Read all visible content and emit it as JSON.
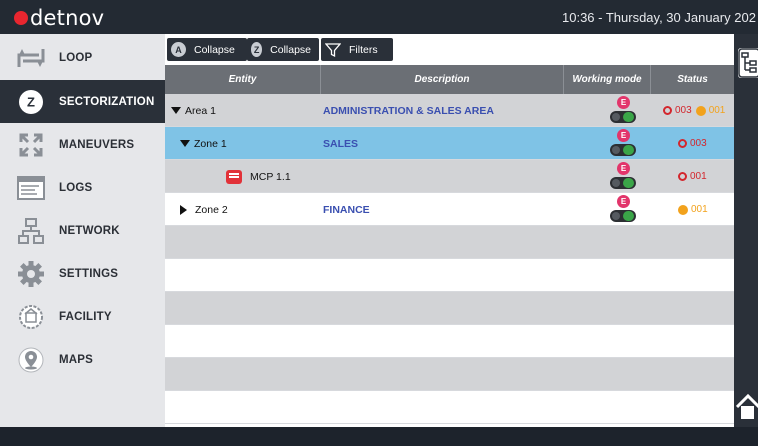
{
  "app": {
    "logo_text": "detnov",
    "clock": "10:36  -  Thursday, 30 January 202"
  },
  "colors": {
    "accent_red": "#e8262f",
    "dark": "#2a3039",
    "link_blue": "#3a4fb0",
    "selected_row": "#7fc3e6",
    "alarm_red": "#d3262d",
    "warning_amber": "#f2a21c",
    "enabled_pink": "#e2356b",
    "toggle_green": "#3aa548"
  },
  "sidebar": {
    "items": [
      {
        "label": "LOOP",
        "icon": "loop-icon"
      },
      {
        "label": "SECTORIZATION",
        "icon": "sectorization-icon",
        "active": true
      },
      {
        "label": "MANEUVERS",
        "icon": "maneuvers-icon"
      },
      {
        "label": "LOGS",
        "icon": "logs-icon"
      },
      {
        "label": "NETWORK",
        "icon": "network-icon"
      },
      {
        "label": "SETTINGS",
        "icon": "gear-icon"
      },
      {
        "label": "FACILITY",
        "icon": "facility-icon"
      },
      {
        "label": "MAPS",
        "icon": "map-pin-icon"
      }
    ]
  },
  "toolbar": {
    "collapse_a": {
      "badge": "A",
      "label": "Collapse"
    },
    "collapse_z": {
      "badge": "Z",
      "label": "Collapse"
    },
    "filters": {
      "label": "Filters"
    }
  },
  "table": {
    "headers": {
      "entity": "Entity",
      "description": "Description",
      "working_mode": "Working mode",
      "status": "Status"
    },
    "rows": [
      {
        "entity": "Area 1",
        "description": "ADMINISTRATION & SALES AREA",
        "mode_badge": "E",
        "status_red": "003",
        "status_amber": "001"
      },
      {
        "entity": "Zone 1",
        "description": "SALES",
        "mode_badge": "E",
        "status_red": "003"
      },
      {
        "entity": "MCP 1.1",
        "description": "",
        "mode_badge": "E",
        "status_red": "001"
      },
      {
        "entity": "Zone 2",
        "description": "FINANCE",
        "mode_badge": "E",
        "status_amber": "001"
      }
    ]
  }
}
